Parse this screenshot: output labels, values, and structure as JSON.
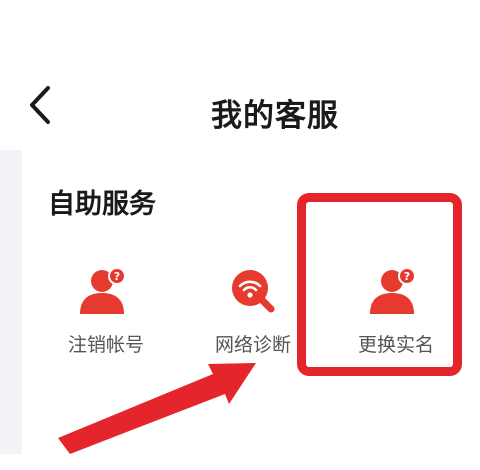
{
  "header": {
    "title": "我的客服"
  },
  "section": {
    "title": "自助服务"
  },
  "services": [
    {
      "label": "注销帐号",
      "icon": "user-help-icon"
    },
    {
      "label": "网络诊断",
      "icon": "wifi-search-icon"
    },
    {
      "label": "更换实名",
      "icon": "user-help-icon"
    }
  ],
  "colors": {
    "accent": "#e5252c",
    "icon_red": "#e63a2f"
  }
}
